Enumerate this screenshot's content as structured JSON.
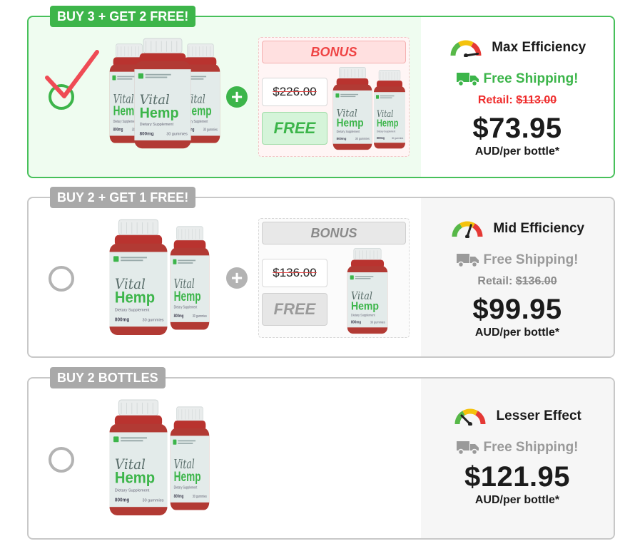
{
  "offers": [
    {
      "tag": "BUY 3 + GET 2 FREE!",
      "selected": true,
      "bonus": {
        "label": "BONUS",
        "old_price": "$226.00",
        "free_label": "FREE"
      },
      "efficiency": "Max Efficiency",
      "shipping": "Free Shipping!",
      "retail_label": "Retail:",
      "retail_price": "$113.00",
      "price": "$73.95",
      "per_unit": "AUD/per bottle*"
    },
    {
      "tag": "BUY 2 + GET 1 FREE!",
      "selected": false,
      "bonus": {
        "label": "BONUS",
        "old_price": "$136.00",
        "free_label": "FREE"
      },
      "efficiency": "Mid Efficiency",
      "shipping": "Free Shipping!",
      "retail_label": "Retail:",
      "retail_price": "$136.00",
      "price": "$99.95",
      "per_unit": "AUD/per bottle*"
    },
    {
      "tag": "BUY 2 BOTTLES",
      "selected": false,
      "efficiency": "Lesser Effect",
      "shipping": "Free Shipping!",
      "price": "$121.95",
      "per_unit": "AUD/per bottle*"
    }
  ],
  "product": {
    "brand_line1": "Vital",
    "brand_line2": "Hemp",
    "sub": "Dietary Supplement",
    "dose": "800mg",
    "count": "30 gummies"
  },
  "colors": {
    "accent_green": "#3cb54a",
    "alert_red": "#ef2b2b",
    "neutral_gray": "#a9a9a9",
    "gauge_red": "#e53935",
    "gauge_yellow": "#f4c20d",
    "gauge_green": "#57b848"
  },
  "icons": {
    "selected": "checkmark-icon",
    "plus": "plus-icon",
    "efficiency": "speedometer-icon",
    "shipping": "truck-icon"
  },
  "gauge_levels": [
    0.95,
    0.6,
    0.25
  ]
}
